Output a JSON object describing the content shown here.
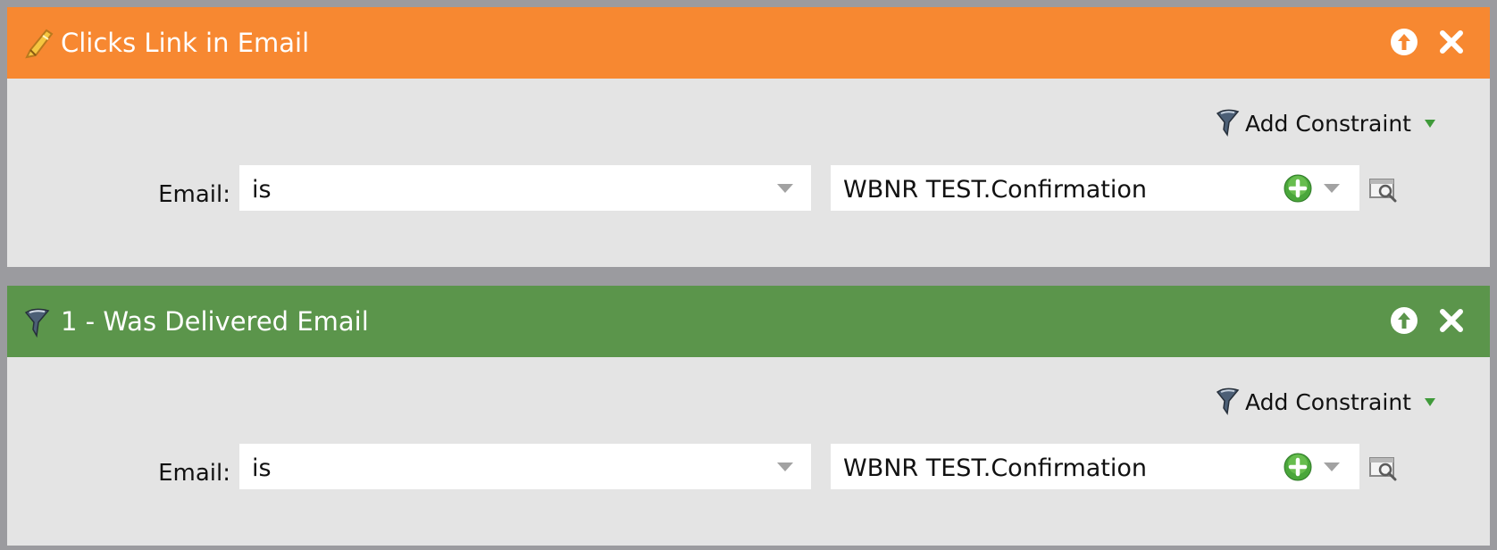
{
  "colors": {
    "trigger_header": "#f78831",
    "filter_header": "#5b954b",
    "panel_bg": "#e4e4e4",
    "frame_bg": "#9b9b9f"
  },
  "filters": [
    {
      "title": "Clicks Link in Email",
      "icon": "trigger-lightning-icon",
      "add_constraint_label": "Add Constraint",
      "field_label": "Email:",
      "operator": "is",
      "value": "WBNR TEST.Confirmation"
    },
    {
      "title": "1 - Was Delivered Email",
      "icon": "filter-funnel-icon",
      "add_constraint_label": "Add Constraint",
      "field_label": "Email:",
      "operator": "is",
      "value": "WBNR TEST.Confirmation"
    }
  ]
}
